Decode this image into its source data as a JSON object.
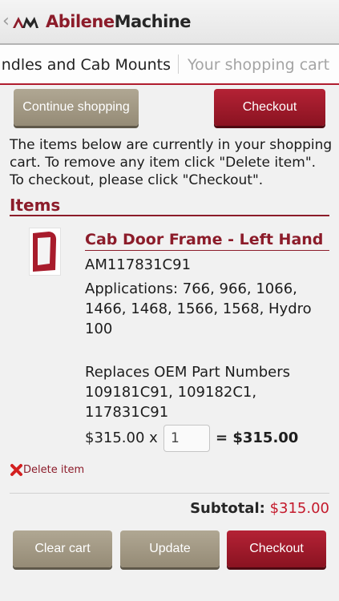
{
  "header": {
    "back_glyph": "‹",
    "logo_icon": "abilene-machine-logo",
    "brand_part1": "Abilene",
    "brand_part2": "Machine",
    "colors": {
      "brand": "#8c1c2a",
      "accent_red": "#c41a2c",
      "button_gray": "#a39a85"
    }
  },
  "breadcrumb": {
    "current": "ndles and Cab Mounts",
    "next": "Your shopping cart"
  },
  "top_buttons": {
    "continue_label": "Continue shopping",
    "checkout_label": "Checkout"
  },
  "intro_text": "The items below are currently in your shopping cart. To remove any item click \"Delete item\". To checkout, please click \"Checkout\".",
  "items_heading": "Items",
  "item": {
    "title": "Cab Door Frame - Left Hand",
    "part_number": "AM117831C91",
    "applications": "Applications: 766, 966, 1066, 1466, 1468, 1566, 1568, Hydro 100",
    "replaces": "Replaces OEM Part Numbers 109181C91, 109182C1, 117831C91",
    "unit_price": "$315.00 x",
    "quantity": "1",
    "line_total": "= $315.00",
    "delete_label": "Delete item",
    "delete_icon": "red-x-icon"
  },
  "summary": {
    "subtotal_label": "Subtotal:",
    "subtotal_value": "$315.00"
  },
  "bottom_buttons": {
    "clear_label": "Clear cart",
    "update_label": "Update",
    "checkout_label": "Checkout"
  }
}
